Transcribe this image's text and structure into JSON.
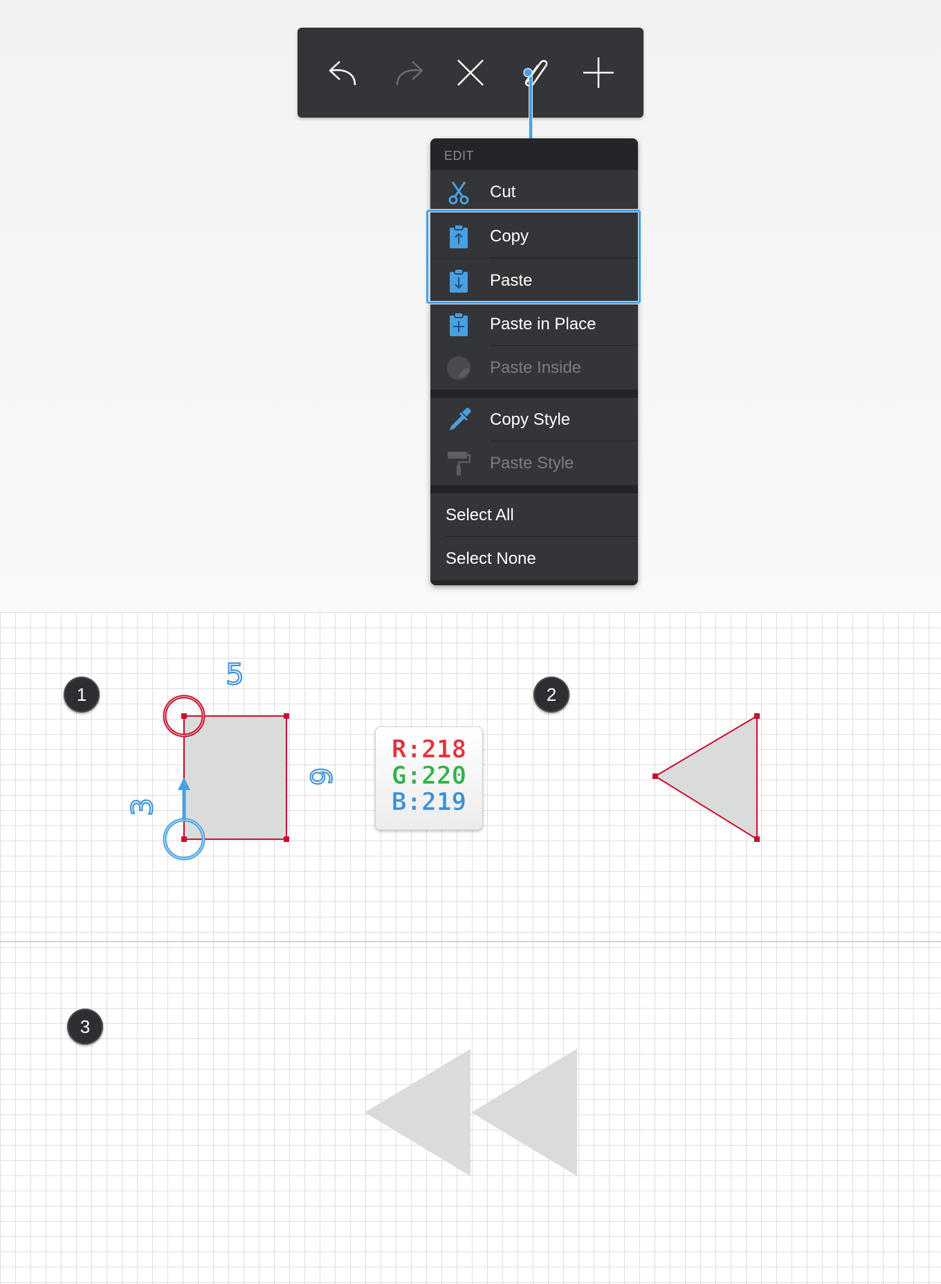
{
  "toolbar": {
    "buttons": [
      {
        "name": "undo-icon",
        "enabled": true
      },
      {
        "name": "redo-icon",
        "enabled": false
      },
      {
        "name": "close-icon",
        "enabled": true
      },
      {
        "name": "paperclip-icon",
        "enabled": true
      },
      {
        "name": "plus-icon",
        "enabled": true
      }
    ]
  },
  "menu": {
    "header": "EDIT",
    "items": [
      {
        "label": "Cut",
        "icon": "scissors-icon",
        "enabled": true
      },
      {
        "label": "Copy",
        "icon": "clipboard-copy-icon",
        "enabled": true
      },
      {
        "label": "Paste",
        "icon": "clipboard-paste-icon",
        "enabled": true
      },
      {
        "label": "Paste in Place",
        "icon": "clipboard-add-icon",
        "enabled": true
      },
      {
        "label": "Paste Inside",
        "icon": "paste-inside-icon",
        "enabled": false
      },
      {
        "label": "Copy Style",
        "icon": "eyedropper-icon",
        "enabled": true
      },
      {
        "label": "Paste Style",
        "icon": "paint-roller-icon",
        "enabled": false
      },
      {
        "label": "Select All",
        "enabled": true
      },
      {
        "label": "Select None",
        "enabled": true
      }
    ]
  },
  "steps": {
    "step1": "1",
    "step2": "2",
    "step3": "3"
  },
  "dimensions": {
    "top": "5",
    "right": "6",
    "left": "3"
  },
  "color_readout": {
    "r": "R:218",
    "g": "G:220",
    "b": "B:219"
  },
  "colors": {
    "accent": "#4a9fe0",
    "toolbar_bg": "#333538",
    "menu_bg": "#2b2c2f",
    "shape_fill": "#dadcdb",
    "anchor_red": "#c8102e"
  }
}
